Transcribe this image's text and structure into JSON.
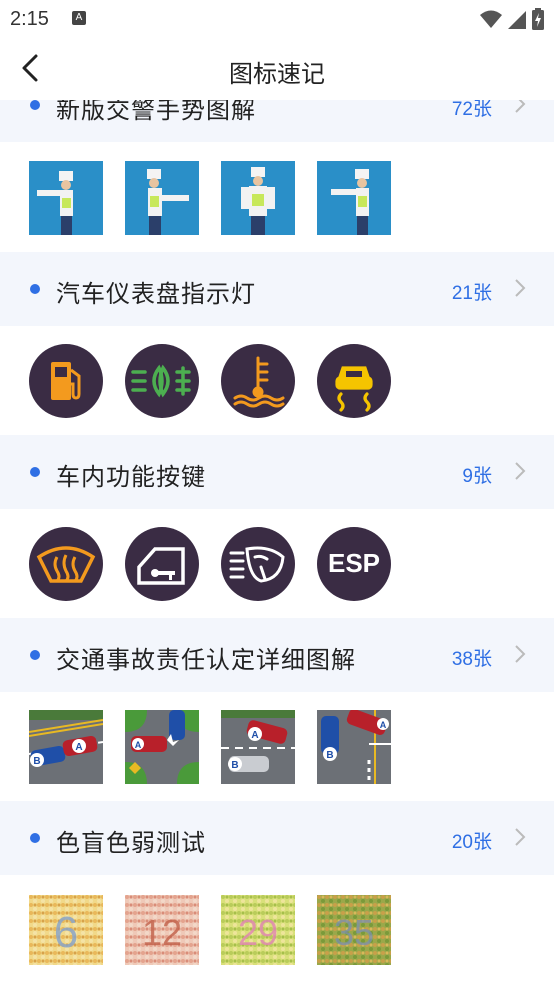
{
  "status": {
    "time": "2:15",
    "notification_icon": "A"
  },
  "header": {
    "title": "图标速记"
  },
  "sections": [
    {
      "title": "新版交警手势图解",
      "count": "72张"
    },
    {
      "title": "汽车仪表盘指示灯",
      "count": "21张"
    },
    {
      "title": "车内功能按键",
      "count": "9张"
    },
    {
      "title": "交通事故责任认定详细图解",
      "count": "38张"
    },
    {
      "title": "色盲色弱测试",
      "count": "20张"
    }
  ],
  "icons": {
    "dashboard": [
      "fuel-icon",
      "fog-light-icon",
      "coolant-temperature-icon",
      "traction-control-icon"
    ],
    "buttons": [
      "rear-defrost-icon",
      "door-lock-icon",
      "windshield-washer-icon",
      "esp-icon"
    ]
  },
  "esp_label": "ESP",
  "accident_labels": {
    "a": "A",
    "b": "B"
  },
  "colorblind_numbers": [
    "6",
    "12",
    "29",
    "35"
  ],
  "colors": {
    "accent": "#2f6fe4",
    "header_bg": "#f3f6fc",
    "icon_bg": "#3a2c44",
    "icon_yellow": "#f5c400",
    "icon_orange": "#f39a1e",
    "icon_green": "#4caf50"
  }
}
